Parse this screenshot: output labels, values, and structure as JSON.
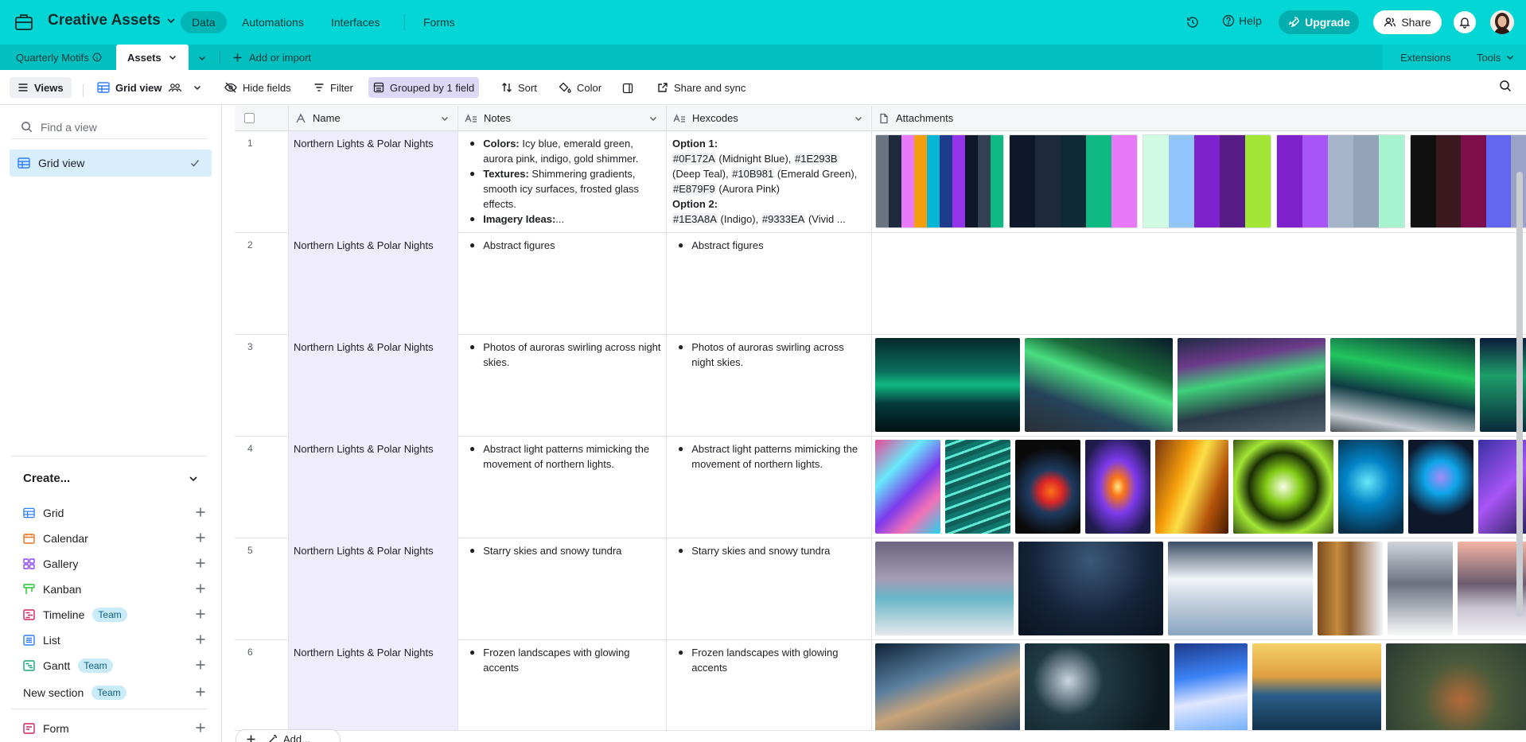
{
  "header": {
    "base_title": "Creative Assets",
    "nav": [
      "Data",
      "Automations",
      "Interfaces",
      "Forms"
    ],
    "help": "Help",
    "upgrade": "Upgrade",
    "share": "Share",
    "brand_color": "#04d5d5"
  },
  "tabs": {
    "items": [
      "Quarterly Motifs",
      "Assets"
    ],
    "add": "Add or import",
    "extensions": "Extensions",
    "tools": "Tools"
  },
  "toolbar": {
    "views": "Views",
    "current_view": "Grid view",
    "hide_fields": "Hide fields",
    "filter": "Filter",
    "grouped": "Grouped by 1 field",
    "sort": "Sort",
    "color": "Color",
    "share_sync": "Share and sync"
  },
  "sidebar": {
    "find_placeholder": "Find a view",
    "views": [
      "Grid view"
    ],
    "create_label": "Create...",
    "create_items": [
      {
        "label": "Grid",
        "icon": "grid-icon",
        "color": "#2d7ff9",
        "team": ""
      },
      {
        "label": "Calendar",
        "icon": "calendar-icon",
        "color": "#e9711e",
        "team": ""
      },
      {
        "label": "Gallery",
        "icon": "gallery-icon",
        "color": "#8b46ff",
        "team": ""
      },
      {
        "label": "Kanban",
        "icon": "kanban-icon",
        "color": "#20c933",
        "team": ""
      },
      {
        "label": "Timeline",
        "icon": "timeline-icon",
        "color": "#d4205c",
        "team": "Team"
      },
      {
        "label": "List",
        "icon": "list-icon",
        "color": "#2d7ff9",
        "team": ""
      },
      {
        "label": "Gantt",
        "icon": "gantt-icon",
        "color": "#11a67a",
        "team": "Team"
      },
      {
        "label": "New section",
        "icon": "",
        "color": "",
        "team": "Team"
      },
      {
        "label": "Form",
        "icon": "form-icon",
        "color": "#d4205c",
        "team": ""
      }
    ]
  },
  "grid": {
    "columns": [
      "Name",
      "Notes",
      "Hexcodes",
      "Attachments"
    ],
    "rows": [
      {
        "num": "1",
        "name": "Northern Lights & Polar Nights",
        "notes": [
          {
            "b": "Colors:",
            "t": " Icy blue, emerald green, aurora pink, indigo, gold shimmer."
          },
          {
            "b": "Textures:",
            "t": " Shimmering gradients, smooth icy surfaces, frosted glass effects."
          },
          {
            "b": "Imagery Ideas:",
            "t": "..."
          }
        ],
        "hex": {
          "opt1": "Option 1:",
          "codes1": [
            [
              "#0F172A",
              " (Midnight Blue), "
            ],
            [
              "#1E293B",
              ""
            ],
            [
              "",
              " (Deep Teal), "
            ],
            [
              "#10B981",
              " (Emerald Green),"
            ],
            [
              "#E879F9",
              " (Aurora Pink)"
            ]
          ],
          "opt2": "Option 2:",
          "codes2": [
            [
              "#1E3A8A",
              " (Indigo), "
            ],
            [
              "#9333EA",
              " (Vivid ..."
            ]
          ]
        }
      },
      {
        "num": "2",
        "name": "Northern Lights & Polar Nights",
        "notes_text": "Abstract figures",
        "hex_text": "Abstract figures"
      },
      {
        "num": "3",
        "name": "Northern Lights & Polar Nights",
        "notes_text": "Photos of auroras swirling across night skies.",
        "hex_text": "Photos of auroras swirling across night skies."
      },
      {
        "num": "4",
        "name": "Northern Lights & Polar Nights",
        "notes_text": "Abstract light patterns mimicking the movement of northern lights.",
        "hex_text": "Abstract light patterns mimicking the movement of northern lights."
      },
      {
        "num": "5",
        "name": "Northern Lights & Polar Nights",
        "notes_text": "Starry skies and snowy tundra",
        "hex_text": "Starry skies and snowy tundra"
      },
      {
        "num": "6",
        "name": "Northern Lights & Polar Nights",
        "notes_text": "Frozen landscapes with glowing accents",
        "hex_text": "Frozen landscapes with glowing accents"
      }
    ]
  },
  "footer": {
    "add": "Add..."
  }
}
